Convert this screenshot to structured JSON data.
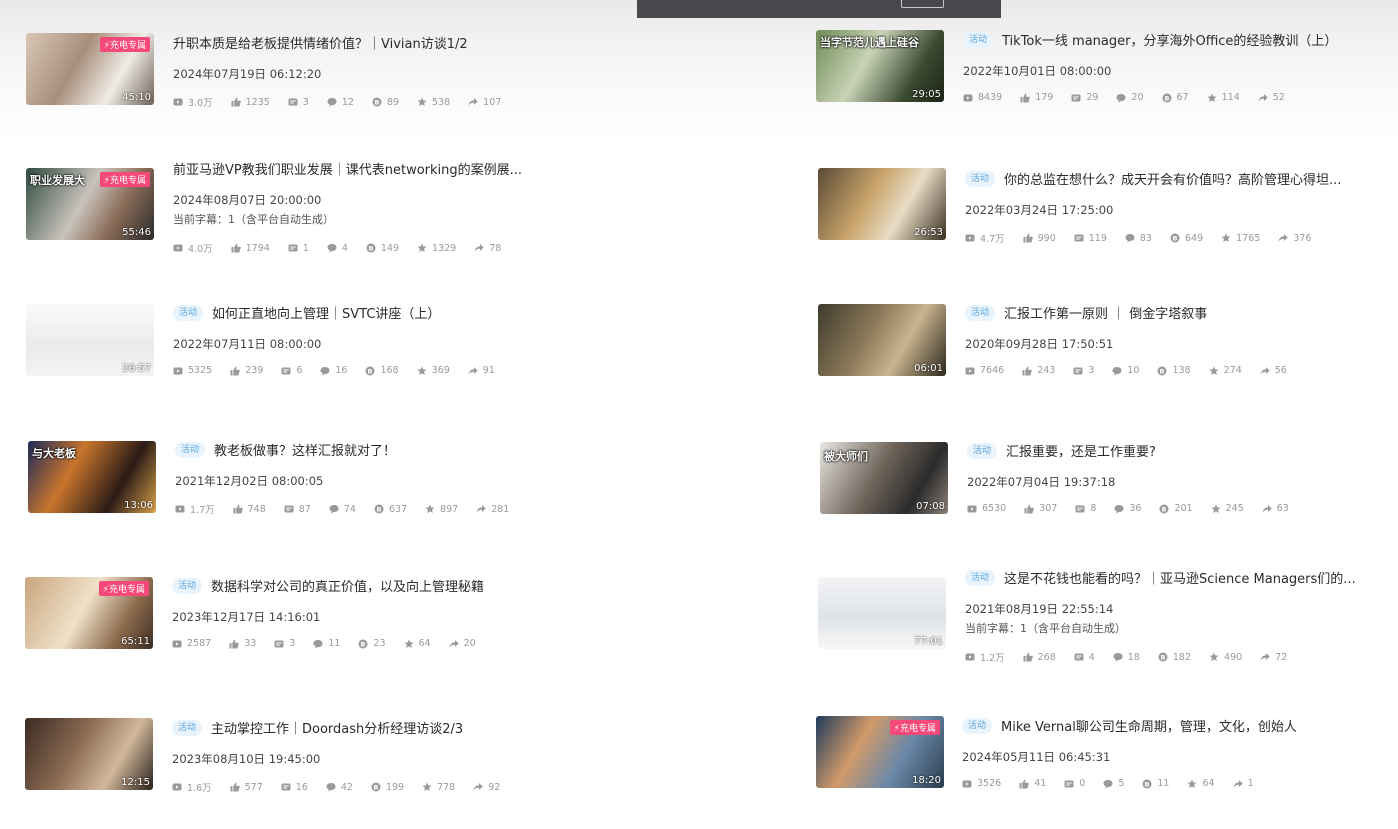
{
  "colors": {
    "charge_badge": "#f5497a",
    "tag_bg": "#e8f3fb",
    "tag_text": "#5aa7e0",
    "stat_text": "#9a9a9a"
  },
  "labels": {
    "activity_tag": "活动",
    "charge_badge": "⚡充电专属"
  },
  "videos": [
    {
      "title": "升职本质是给老板提供情绪价值？｜Vivian访谈1/2",
      "date": "2024年07月19日 06:12:20",
      "subtitle": "",
      "duration": "45:10",
      "tagged": false,
      "charge": true,
      "stats": {
        "views": "3.0万",
        "likes": "1235",
        "danmaku": "3",
        "comments": "12",
        "coins": "89",
        "favorites": "538",
        "shares": "107"
      }
    },
    {
      "title": "前亚马逊VP教我们职业发展｜课代表networking的案例展...",
      "date": "2024年08月07日 20:00:00",
      "subtitle": "当前字幕：1（含平台自动生成）",
      "duration": "55:46",
      "tagged": false,
      "charge": true,
      "caption": "职业发展大",
      "stats": {
        "views": "4.0万",
        "likes": "1794",
        "danmaku": "1",
        "comments": "4",
        "coins": "149",
        "favorites": "1329",
        "shares": "78"
      }
    },
    {
      "title": "如何正直地向上管理｜SVTC讲座（上）",
      "date": "2022年07月11日 08:00:00",
      "subtitle": "",
      "duration": "26:57",
      "tagged": true,
      "charge": false,
      "stats": {
        "views": "5325",
        "likes": "239",
        "danmaku": "6",
        "comments": "16",
        "coins": "168",
        "favorites": "369",
        "shares": "91"
      }
    },
    {
      "title": "教老板做事？这样汇报就对了！",
      "date": "2021年12月02日 08:00:05",
      "subtitle": "",
      "duration": "13:06",
      "tagged": true,
      "charge": false,
      "caption": "与大老板",
      "stats": {
        "views": "1.7万",
        "likes": "748",
        "danmaku": "87",
        "comments": "74",
        "coins": "637",
        "favorites": "897",
        "shares": "281"
      }
    },
    {
      "title": "数据科学对公司的真正价值，以及向上管理秘籍",
      "date": "2023年12月17日 14:16:01",
      "subtitle": "",
      "duration": "65:11",
      "tagged": true,
      "charge": true,
      "stats": {
        "views": "2587",
        "likes": "33",
        "danmaku": "3",
        "comments": "11",
        "coins": "23",
        "favorites": "64",
        "shares": "20"
      }
    },
    {
      "title": "主动掌控工作｜Doordash分析经理访谈2/3",
      "date": "2023年08月10日 19:45:00",
      "subtitle": "",
      "duration": "12:15",
      "tagged": true,
      "charge": false,
      "stats": {
        "views": "1.6万",
        "likes": "577",
        "danmaku": "16",
        "comments": "42",
        "coins": "199",
        "favorites": "778",
        "shares": "92"
      }
    },
    {
      "title": "TikTok一线 manager，分享海外Office的经验教训（上）",
      "date": "2022年10月01日 08:00:00",
      "subtitle": "",
      "duration": "29:05",
      "tagged": true,
      "charge": false,
      "caption": "当字节范儿遇上硅谷",
      "stats": {
        "views": "8439",
        "likes": "179",
        "danmaku": "29",
        "comments": "20",
        "coins": "67",
        "favorites": "114",
        "shares": "52"
      }
    },
    {
      "title": "你的总监在想什么？成天开会有价值吗？高阶管理心得坦...",
      "date": "2022年03月24日 17:25:00",
      "subtitle": "",
      "duration": "26:53",
      "tagged": true,
      "charge": false,
      "stats": {
        "views": "4.7万",
        "likes": "990",
        "danmaku": "119",
        "comments": "83",
        "coins": "649",
        "favorites": "1765",
        "shares": "376"
      }
    },
    {
      "title": "汇报工作第一原则 ｜ 倒金字塔叙事",
      "date": "2020年09月28日 17:50:51",
      "subtitle": "",
      "duration": "06:01",
      "tagged": true,
      "charge": false,
      "stats": {
        "views": "7646",
        "likes": "243",
        "danmaku": "3",
        "comments": "10",
        "coins": "138",
        "favorites": "274",
        "shares": "56"
      }
    },
    {
      "title": "汇报重要，还是工作重要?",
      "date": "2022年07月04日 19:37:18",
      "subtitle": "",
      "duration": "07:08",
      "tagged": true,
      "charge": false,
      "caption": "被大师们",
      "stats": {
        "views": "6530",
        "likes": "307",
        "danmaku": "8",
        "comments": "36",
        "coins": "201",
        "favorites": "245",
        "shares": "63"
      }
    },
    {
      "title": "这是不花钱也能看的吗？｜亚马逊Science Managers们的...",
      "date": "2021年08月19日 22:55:14",
      "subtitle": "当前字幕：1（含平台自动生成）",
      "duration": "77:01",
      "tagged": true,
      "charge": false,
      "stats": {
        "views": "1.2万",
        "likes": "268",
        "danmaku": "4",
        "comments": "18",
        "coins": "182",
        "favorites": "490",
        "shares": "72"
      }
    },
    {
      "title": "Mike Vernal聊公司生命周期，管理，文化，创始人",
      "date": "2024年05月11日 06:45:31",
      "subtitle": "",
      "duration": "18:20",
      "tagged": true,
      "charge": true,
      "stats": {
        "views": "3526",
        "likes": "41",
        "danmaku": "0",
        "comments": "5",
        "coins": "11",
        "favorites": "64",
        "shares": "1"
      }
    }
  ]
}
